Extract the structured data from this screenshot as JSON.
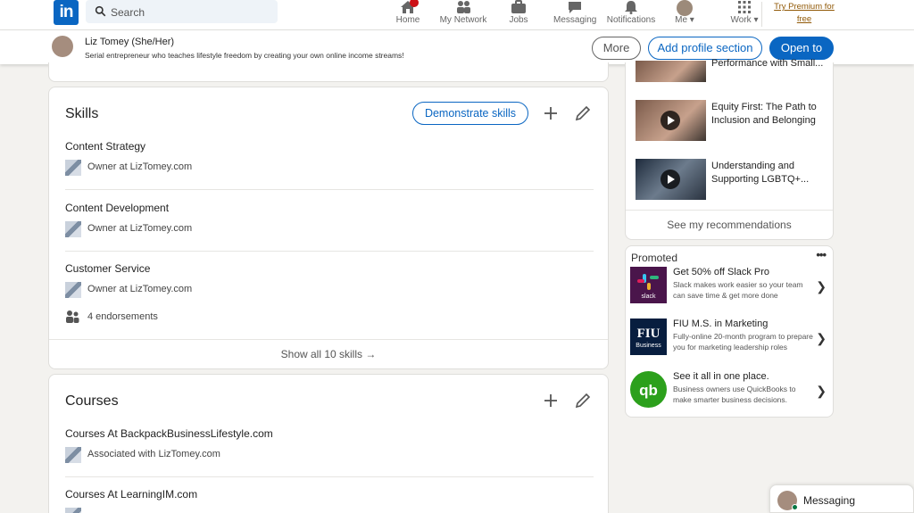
{
  "nav": {
    "logo": "in",
    "search_placeholder": "Search",
    "items": [
      {
        "label": "Home"
      },
      {
        "label": "My Network"
      },
      {
        "label": "Jobs"
      },
      {
        "label": "Messaging"
      },
      {
        "label": "Notifications"
      },
      {
        "label": "Me ▾"
      },
      {
        "label": "Work ▾"
      }
    ],
    "premium": "Try Premium for free"
  },
  "profile_bar": {
    "name": "Liz Tomey (She/Her)",
    "headline": "Serial entrepreneur who teaches lifestyle freedom by creating your own online income streams!",
    "more_button": "More",
    "add_section_button": "Add profile section",
    "open_to_button": "Open to"
  },
  "skills": {
    "title": "Skills",
    "demonstrate_button": "Demonstrate skills",
    "items": [
      {
        "name": "Content Strategy",
        "context": "Owner at LizTomey.com"
      },
      {
        "name": "Content Development",
        "context": "Owner at LizTomey.com"
      },
      {
        "name": "Customer Service",
        "context": "Owner at LizTomey.com",
        "endorsements": "4 endorsements"
      }
    ],
    "show_all": "Show all 10 skills →"
  },
  "courses": {
    "title": "Courses",
    "items": [
      {
        "name": "Courses At BackpackBusinessLifestyle.com",
        "context": "Associated with LizTomey.com"
      },
      {
        "name": "Courses At LearningIM.com"
      }
    ]
  },
  "learning": {
    "partial_title": "Performance with Small...",
    "videos": [
      {
        "title": "Equity First: The Path to Inclusion and Belonging"
      },
      {
        "title": "Understanding and Supporting LGBTQ+..."
      }
    ],
    "see_more": "See my recommendations"
  },
  "promoted": {
    "label": "Promoted",
    "ads": [
      {
        "title": "Get 50% off Slack Pro",
        "desc": "Slack makes work easier so your team can save time & get more done",
        "logo_text": "slack",
        "color": "#4a154b"
      },
      {
        "title": "FIU M.S. in Marketing",
        "desc": "Fully-online 20-month program to prepare you for marketing leadership roles",
        "logo_text": "FIU",
        "logo_sub": "Business",
        "color": "#081e3f"
      },
      {
        "title": "See it all in one place.",
        "desc": "Business owners use QuickBooks to make smarter business decisions.",
        "logo_text": "qb",
        "color": "#2ca01c"
      }
    ]
  },
  "messaging": {
    "label": "Messaging"
  },
  "colors": {
    "brand": "#0a66c2",
    "badge": "#cc1016",
    "premium": "#915907"
  }
}
